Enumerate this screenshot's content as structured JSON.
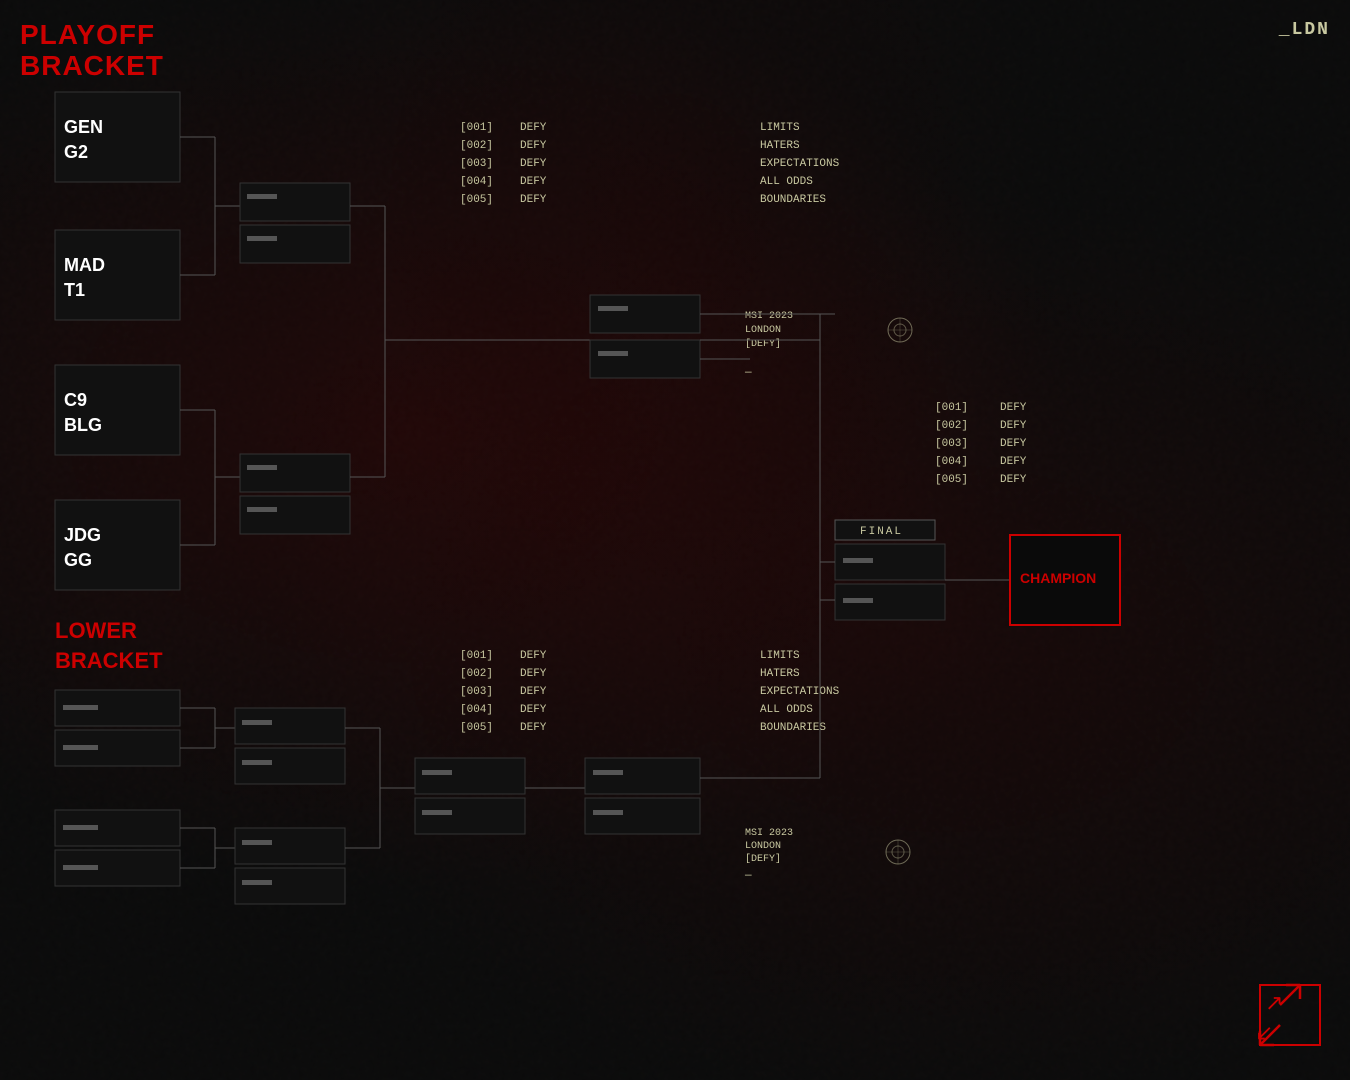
{
  "header": {
    "playoff_bracket_line1": "PLAYOFF",
    "playoff_bracket_line2": "BRACKET",
    "location": "_LDN"
  },
  "upper_bracket": {
    "section_label_line1": "PLAYOFF",
    "section_label_line2": "BRACKET",
    "teams": [
      {
        "id": "gen_g2",
        "line1": "GEN",
        "line2": "G2"
      },
      {
        "id": "mad_t1",
        "line1": "MAD",
        "line2": "T1"
      },
      {
        "id": "c9_blg",
        "line1": "C9",
        "line2": "BLG"
      },
      {
        "id": "jdg_gg",
        "line1": "JDG",
        "line2": "GG"
      }
    ],
    "defy_list": [
      {
        "num": "[001]",
        "verb": "DEFY",
        "target": "LIMITS"
      },
      {
        "num": "[002]",
        "verb": "DEFY",
        "target": "HATERS"
      },
      {
        "num": "[003]",
        "verb": "DEFY",
        "target": "EXPECTATIONS"
      },
      {
        "num": "[004]",
        "verb": "DEFY",
        "target": "ALL ODDS"
      },
      {
        "num": "[005]",
        "verb": "DEFY",
        "target": "BOUNDARIES"
      }
    ],
    "msi_label": "MSI 2023",
    "london_label": "LONDON",
    "defy_bracket": "[DEFY]",
    "final_label": "FINAL",
    "champion_label": "CHAMPION"
  },
  "lower_bracket": {
    "section_label_line1": "LOWER",
    "section_label_line2": "BRACKET",
    "defy_list": [
      {
        "num": "[001]",
        "verb": "DEFY",
        "target": "LIMITS"
      },
      {
        "num": "[002]",
        "verb": "DEFY",
        "target": "HATERS"
      },
      {
        "num": "[003]",
        "verb": "DEFY",
        "target": "EXPECTATIONS"
      },
      {
        "num": "[004]",
        "verb": "DEFY",
        "target": "ALL ODDS"
      },
      {
        "num": "[005]",
        "verb": "DEFY",
        "target": "BOUNDARIES"
      }
    ],
    "msi_label": "MSI 2023",
    "london_label": "LONDON",
    "defy_bracket": "[DEFY]"
  },
  "final_defy_list": [
    {
      "num": "[001]",
      "verb": "DEFY"
    },
    {
      "num": "[002]",
      "verb": "DEFY"
    },
    {
      "num": "[003]",
      "verb": "DEFY"
    },
    {
      "num": "[004]",
      "verb": "DEFY"
    },
    {
      "num": "[005]",
      "verb": "DEFY"
    }
  ]
}
